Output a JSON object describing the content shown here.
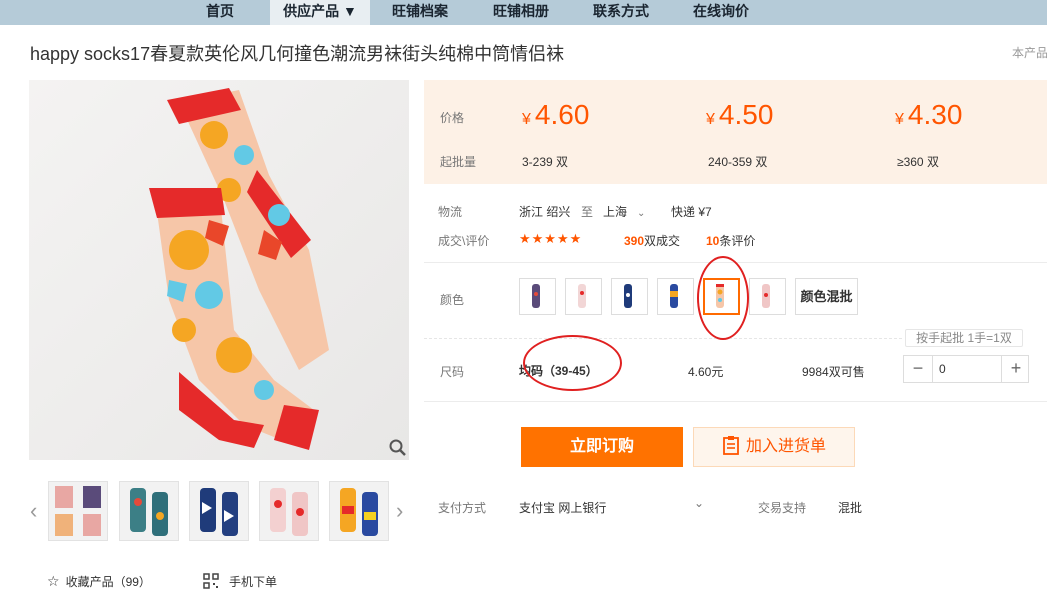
{
  "nav": {
    "items": [
      "首页",
      "供应产品 ▼",
      "旺铺档案",
      "旺铺相册",
      "联系方式",
      "在线询价"
    ]
  },
  "product": {
    "title": "happy socks17春夏款英伦风几何撞色潮流男袜街头纯棉中筒情侣袜",
    "right_cut": "本产品"
  },
  "price": {
    "price_label": "价格",
    "moq_label": "起批量",
    "yen": "¥",
    "tiers": [
      {
        "price": "4.60",
        "qty": "3-239 双"
      },
      {
        "price": "4.50",
        "qty": "240-359 双"
      },
      {
        "price": "4.30",
        "qty": "≥360 双"
      }
    ]
  },
  "logistics": {
    "label": "物流",
    "from": "浙江  绍兴",
    "to_word": "至",
    "to": "上海",
    "express": "快递 ¥7"
  },
  "deals": {
    "label": "成交\\评价",
    "stars": "★★★★★",
    "deal_count": "390",
    "deal_suffix": "双成交",
    "review_count": "10",
    "review_suffix": "条评价"
  },
  "color": {
    "label": "颜色",
    "mixed_label": "颜色混批"
  },
  "size": {
    "hint": "按手起批 1手=1双",
    "label": "尺码",
    "name": "均码（39-45）",
    "price": "4.60元",
    "stock": "9984双可售",
    "qty": "0",
    "minus": "−",
    "plus": "+"
  },
  "actions": {
    "buy": "立即订购",
    "cart": "加入进货单"
  },
  "payment": {
    "label": "支付方式",
    "methods": "支付宝  网上银行",
    "support_label": "交易支持",
    "support_value": "混批"
  },
  "footer": {
    "fav": "收藏产品（99）",
    "mobile": "手机下单"
  },
  "colors": {
    "accent": "#ff5500",
    "buy_button": "#ff7200",
    "nav_bg": "#b5cbd8",
    "annotation": "#e02020"
  }
}
